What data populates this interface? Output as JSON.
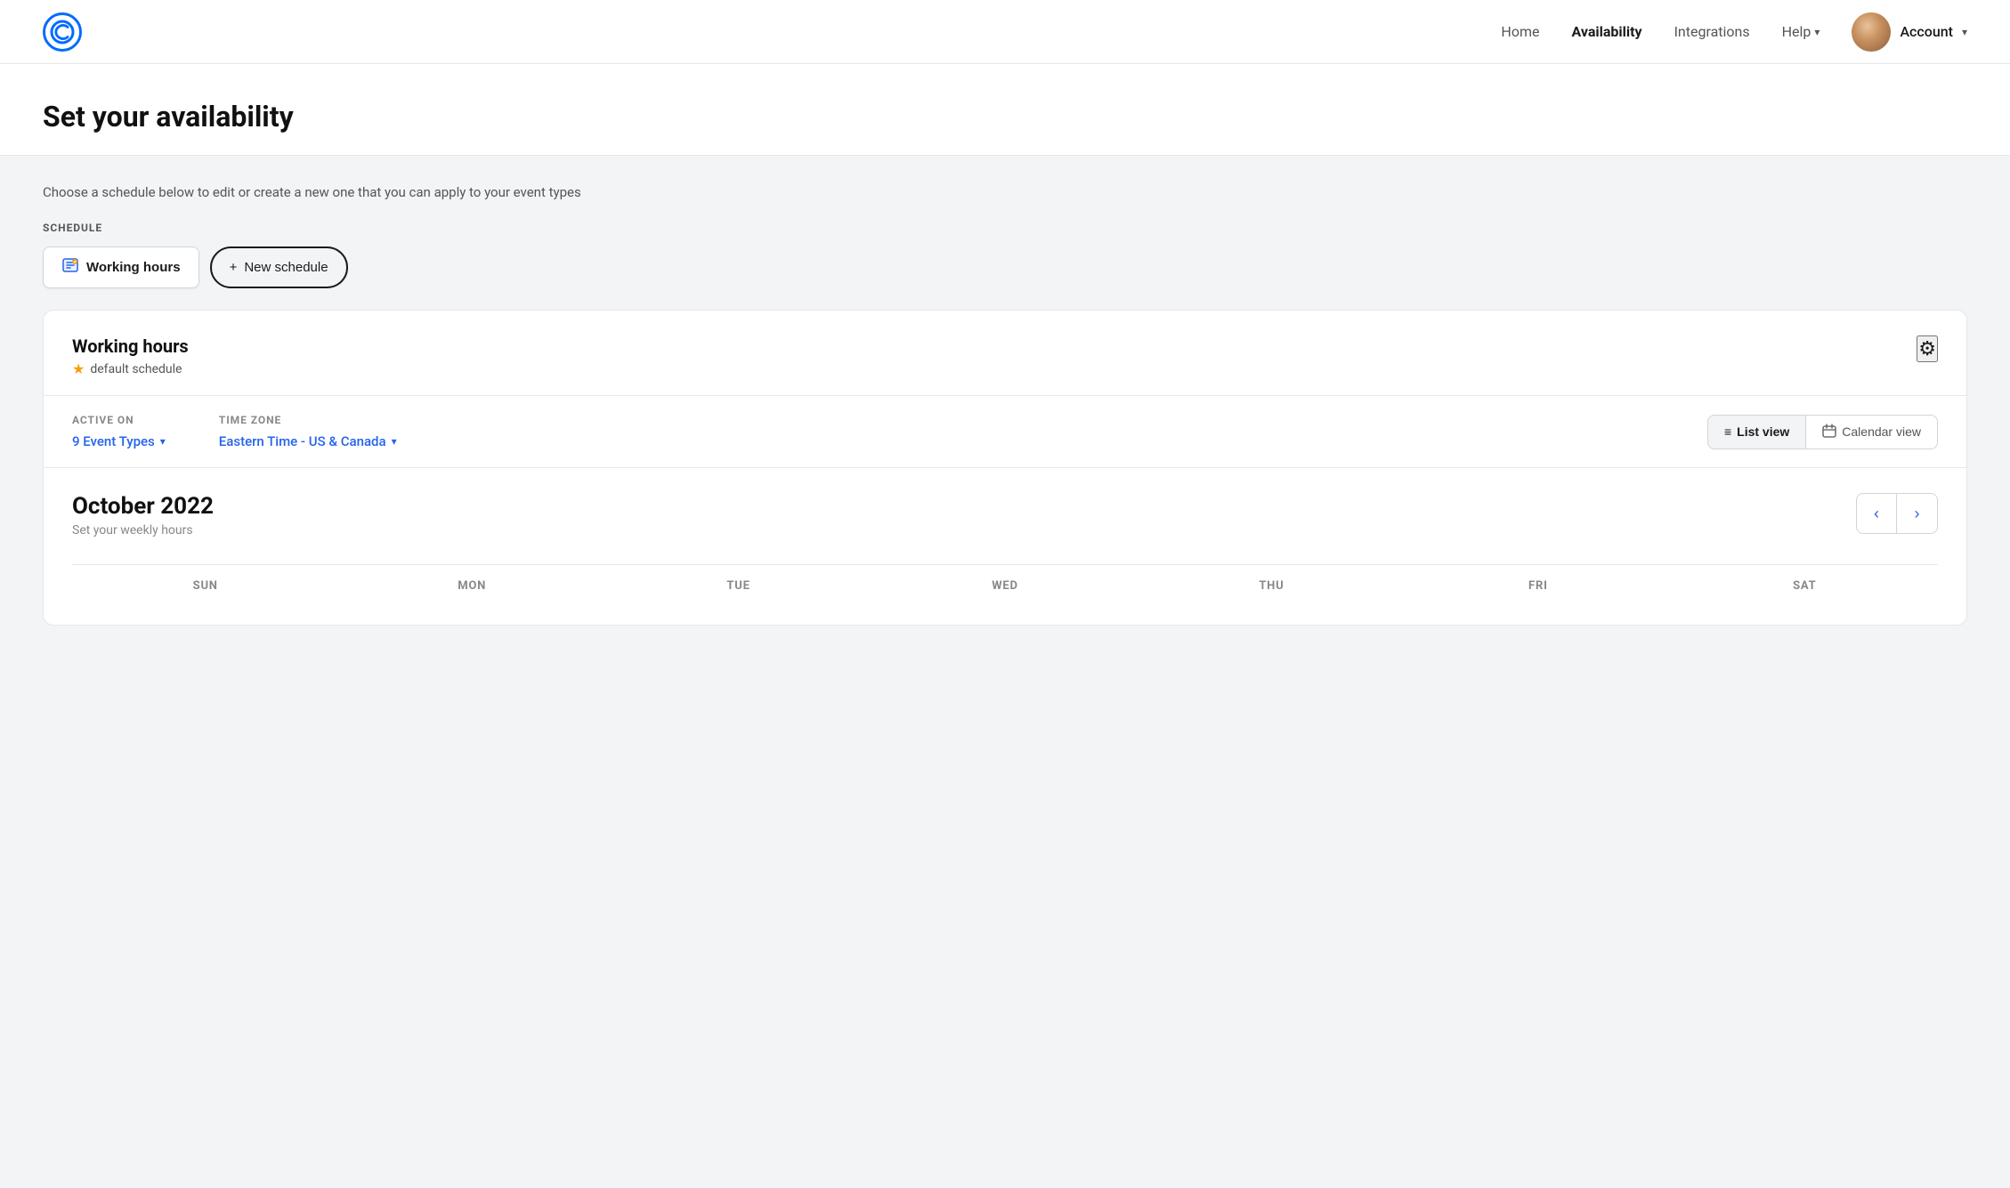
{
  "nav": {
    "logo_text": "C",
    "links": [
      {
        "id": "home",
        "label": "Home",
        "active": false
      },
      {
        "id": "availability",
        "label": "Availability",
        "active": true
      },
      {
        "id": "integrations",
        "label": "Integrations",
        "active": false
      },
      {
        "id": "help",
        "label": "Help",
        "has_arrow": true
      }
    ],
    "account_label": "Account"
  },
  "page": {
    "title": "Set your availability",
    "subtitle": "Choose a schedule below to edit or create a new one that you can apply to your event types"
  },
  "schedule_section": {
    "label": "SCHEDULE",
    "pills": [
      {
        "id": "working-hours",
        "label": "Working hours",
        "icon": "📋",
        "active": true
      },
      {
        "id": "new-schedule",
        "label": "New schedule",
        "prefix": "+",
        "active": false
      }
    ]
  },
  "schedule_card": {
    "title": "Working hours",
    "default_label": "default schedule",
    "active_on_label": "ACTIVE ON",
    "active_on_value": "9 Event Types",
    "timezone_label": "TIME ZONE",
    "timezone_value": "Eastern Time - US & Canada",
    "view_buttons": [
      {
        "id": "list-view",
        "label": "List view",
        "icon": "≡",
        "active": true
      },
      {
        "id": "calendar-view",
        "label": "Calendar view",
        "icon": "📅",
        "active": false
      }
    ]
  },
  "calendar": {
    "month": "October 2022",
    "subtitle": "Set your weekly hours",
    "days": [
      "SUN",
      "MON",
      "TUE",
      "WED",
      "THU",
      "FRI",
      "SAT"
    ]
  },
  "colors": {
    "accent_blue": "#2563eb",
    "accent_yellow": "#f59e0b"
  }
}
